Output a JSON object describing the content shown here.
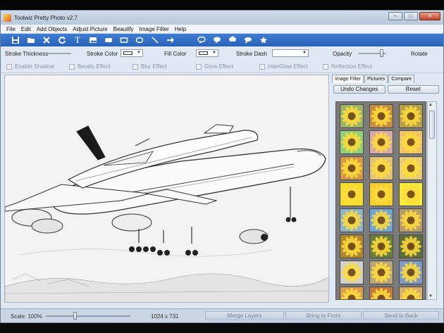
{
  "window": {
    "title": "Toolwiz Pretty Photo v2.7"
  },
  "menu": [
    "File",
    "Edit",
    "Add Objects",
    "Adjust Picture",
    "Beautify",
    "Image Filter",
    "Help"
  ],
  "toolbar": {
    "tools": [
      "save-icon",
      "open-icon",
      "close-icon",
      "rotate-icon",
      "text-icon",
      "image-icon",
      "rounded-rect-icon",
      "rectangle-icon",
      "ellipse-icon",
      "line-icon",
      "arrow-icon",
      "speech-bubble-icon",
      "thought-bubble-icon",
      "callout-icon",
      "cloud-icon",
      "star-icon"
    ],
    "text_tool_glyph": "T"
  },
  "properties": {
    "stroke_thickness": "Stroke Thickness",
    "stroke_color": "Stroke Color",
    "fill_color": "Fill Color",
    "stroke_dash": "Stroke Dash",
    "opacity": "Opacity",
    "opacity_level": 0.85,
    "rotate": "Rotate"
  },
  "effects": [
    "Enable Shadow",
    "Bevels Effect",
    "Blur Effect",
    "Glow Effect",
    "InterGlow Effect",
    "Reflection Effect"
  ],
  "panel": {
    "tabs": [
      "Image Filter",
      "Pictures",
      "Compare"
    ],
    "active_tab": "Image Filter",
    "undo_label": "Undo Changes",
    "reset_label": "Reset",
    "thumb_tints": [
      "#9bb566",
      "#c58d3f",
      "#b6a14a",
      "#8fd07a",
      "#d9a9a9",
      "#f0c36a",
      "#d49a43",
      "#e2c27a",
      "#e8cc73",
      "#f3dd2b",
      "#f5cf2e",
      "#f7ea3a",
      "#8fb3c8",
      "#6fa4d9",
      "#b79d6a",
      "#b0862f",
      "#6b7d3a",
      "#5c6e3a",
      "#d0d0d0",
      "#b8a67a",
      "#7c9ac9",
      "#d9a050",
      "#c47a38",
      "#d9b06a"
    ]
  },
  "status": {
    "scale": "Scale: 100%",
    "scale_level": 0.35,
    "dimensions": "1024 x 731",
    "merge_layers": "Merge Layers",
    "bring_to_front": "Bring to Front",
    "send_to_back": "Send to Back"
  }
}
